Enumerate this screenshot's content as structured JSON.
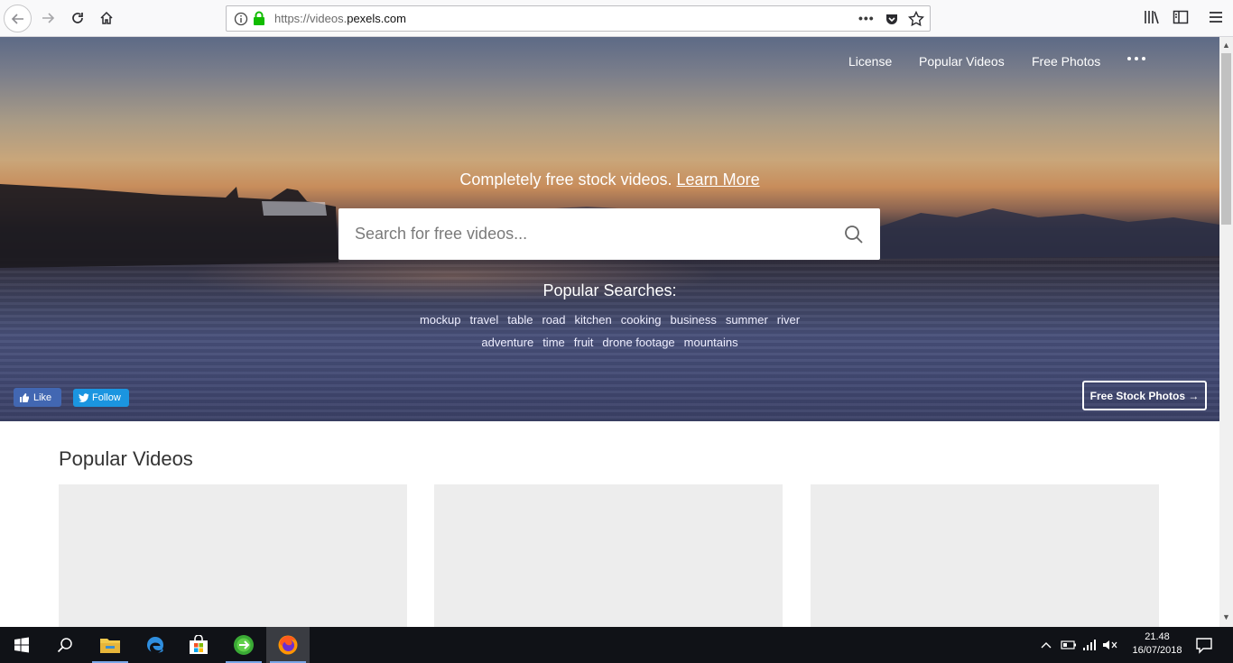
{
  "browser": {
    "url_prefix": "https://videos.",
    "url_host": "pexels.com",
    "url_more": "•••"
  },
  "nav": {
    "license": "License",
    "popular_videos": "Popular Videos",
    "free_photos": "Free Photos"
  },
  "hero": {
    "tagline": "Completely free stock videos.",
    "learn_more": "Learn More",
    "search_placeholder": "Search for free videos...",
    "popular_title": "Popular Searches:",
    "tags_row1": [
      "mockup",
      "travel",
      "table",
      "road",
      "kitchen",
      "cooking",
      "business",
      "summer",
      "river"
    ],
    "tags_row2": [
      "adventure",
      "time",
      "fruit",
      "drone footage",
      "mountains"
    ],
    "like_label": "Like",
    "follow_label": "Follow",
    "free_stock_photos": "Free Stock Photos →"
  },
  "content": {
    "section_title": "Popular Videos"
  },
  "taskbar": {
    "time": "21.48",
    "date": "16/07/2018"
  },
  "colors": {
    "facebook": "#4267b2",
    "twitter": "#1b95e0",
    "lock_green": "#12bc00",
    "card_placeholder": "#ededed"
  }
}
